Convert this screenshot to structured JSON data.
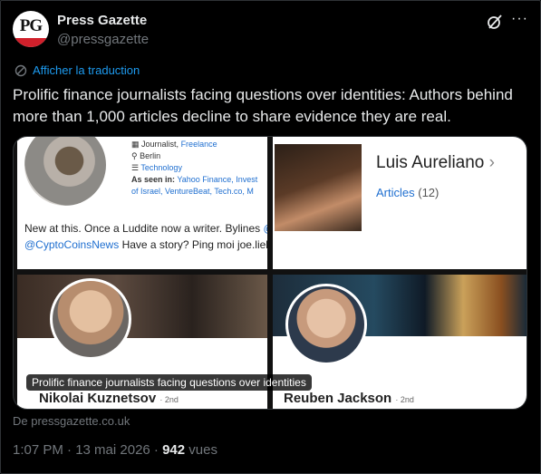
{
  "account": {
    "name": "Press Gazette",
    "handle": "@pressgazette",
    "avatar_text": "PG"
  },
  "actions": {
    "grok_icon": "grok-icon",
    "more_label": "···"
  },
  "translate_label": "Afficher la traduction",
  "tweet_text": "Prolific finance journalists facing questions over identities: Authors behind more than 1,000 articles decline to share evidence they are real.",
  "card": {
    "tile1": {
      "role": "Journalist,",
      "role_link": "Freelance",
      "location": "Berlin",
      "topic": "Technology",
      "seen_label": "As seen in:",
      "seen_outlets_1": "Yahoo Finance, Invest",
      "seen_outlets_2": "of Israel, VentureBeat, Tech.co, M",
      "bio_line1": "New at this. Once a Luddite now a writer. Bylines",
      "bio_line1_link": "@",
      "bio_line2_link": "@CyptoCoinsNews",
      "bio_line2": "Have a story? Ping moi joe.lieb"
    },
    "tile2": {
      "name": "Luis Aureliano",
      "chevron": "›",
      "articles_label": "Articles",
      "articles_count": "(12)"
    },
    "tile3": {
      "name": "Nikolai Kuznetsov",
      "degree": "· 2nd"
    },
    "tile4": {
      "name": "Reuben Jackson",
      "degree": "· 2nd"
    },
    "caption": "Prolific finance journalists facing questions over identities"
  },
  "source": "De pressgazette.co.uk",
  "footer": {
    "time_date": "1:07 PM · 13 mai 2026 ·",
    "views_count": "942",
    "views_label": "vues"
  },
  "colors": {
    "accent": "#1d9bf0",
    "muted": "#71767b",
    "text": "#e7e9ea",
    "background": "#000000"
  }
}
